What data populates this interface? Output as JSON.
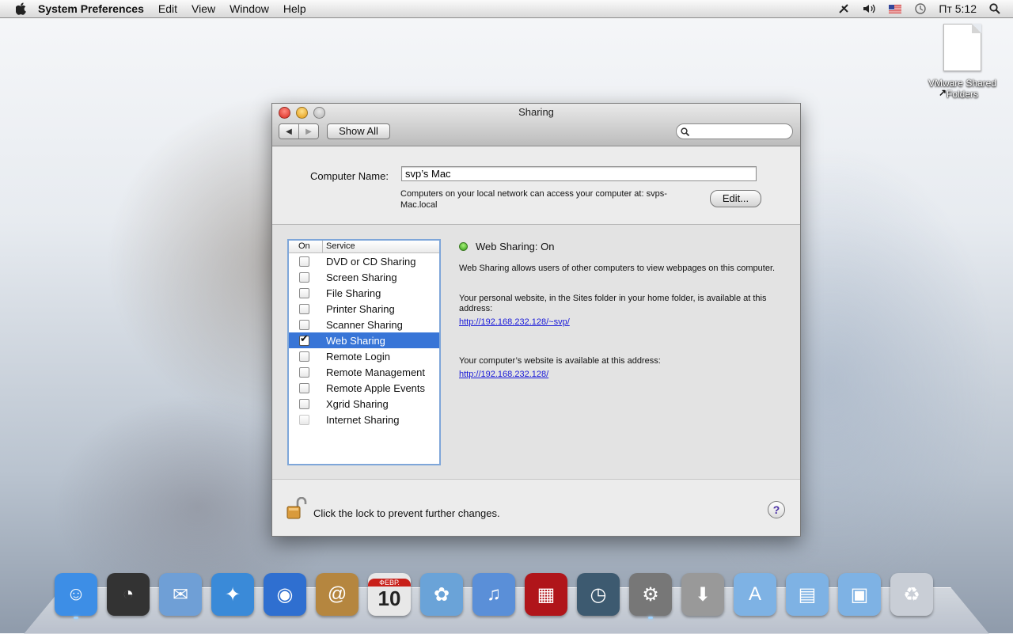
{
  "menubar": {
    "app": "System Preferences",
    "menus": [
      "Edit",
      "View",
      "Window",
      "Help"
    ],
    "clock": "Пт 5:12"
  },
  "desktop": {
    "icon_label_line1": "VMware Shared",
    "icon_label_line2": "Folders"
  },
  "window": {
    "title": "Sharing",
    "show_all": "Show All",
    "search_placeholder": "",
    "computer_name_label": "Computer Name:",
    "computer_name_value": "svp’s Mac",
    "access_desc": "Computers on your local network can access your computer at: svps-Mac.local",
    "edit_button": "Edit...",
    "table": {
      "col_on": "On",
      "col_service": "Service",
      "services": [
        {
          "label": "DVD or CD Sharing",
          "checked": false
        },
        {
          "label": "Screen Sharing",
          "checked": false
        },
        {
          "label": "File Sharing",
          "checked": false
        },
        {
          "label": "Printer Sharing",
          "checked": false
        },
        {
          "label": "Scanner Sharing",
          "checked": false
        },
        {
          "label": "Web Sharing",
          "checked": true
        },
        {
          "label": "Remote Login",
          "checked": false
        },
        {
          "label": "Remote Management",
          "checked": false
        },
        {
          "label": "Remote Apple Events",
          "checked": false
        },
        {
          "label": "Xgrid Sharing",
          "checked": false
        },
        {
          "label": "Internet Sharing",
          "checked": false
        }
      ]
    },
    "detail": {
      "status": "Web Sharing: On",
      "desc": "Web Sharing allows users of other computers to view webpages on this computer.",
      "personal_desc": "Your personal website, in the Sites folder in your home folder, is available at this address:",
      "personal_url": "http://192.168.232.128/~svp/",
      "computer_desc": "Your computer’s website is available at this address:",
      "computer_url": "http://192.168.232.128/"
    },
    "lock_text": "Click the lock to prevent further changes.",
    "help": "?"
  },
  "dock": {
    "items": [
      {
        "name": "finder",
        "color": "#3d8ee6"
      },
      {
        "name": "dashboard",
        "color": "#333333"
      },
      {
        "name": "mail",
        "color": "#6f9fd6"
      },
      {
        "name": "safari",
        "color": "#3a8ad8"
      },
      {
        "name": "ichat",
        "color": "#2f6fd0"
      },
      {
        "name": "address-book",
        "color": "#b5863f"
      },
      {
        "name": "ical",
        "color": "#e8e8e8",
        "month": "ФЕВР.",
        "day": "10"
      },
      {
        "name": "iphoto",
        "color": "#6aa3d8"
      },
      {
        "name": "itunes",
        "color": "#5a8fd8"
      },
      {
        "name": "photo-booth",
        "color": "#b0151a"
      },
      {
        "name": "time-machine",
        "color": "#3d5a70"
      },
      {
        "name": "system-preferences",
        "color": "#777777"
      },
      {
        "name": "downloads-stack",
        "color": "#999999"
      },
      {
        "name": "applications-folder",
        "color": "#7eb2e4"
      },
      {
        "name": "documents-folder",
        "color": "#7eb2e4"
      },
      {
        "name": "downloads-folder",
        "color": "#7eb2e4"
      },
      {
        "name": "trash",
        "color": "#c9ced6"
      }
    ]
  }
}
